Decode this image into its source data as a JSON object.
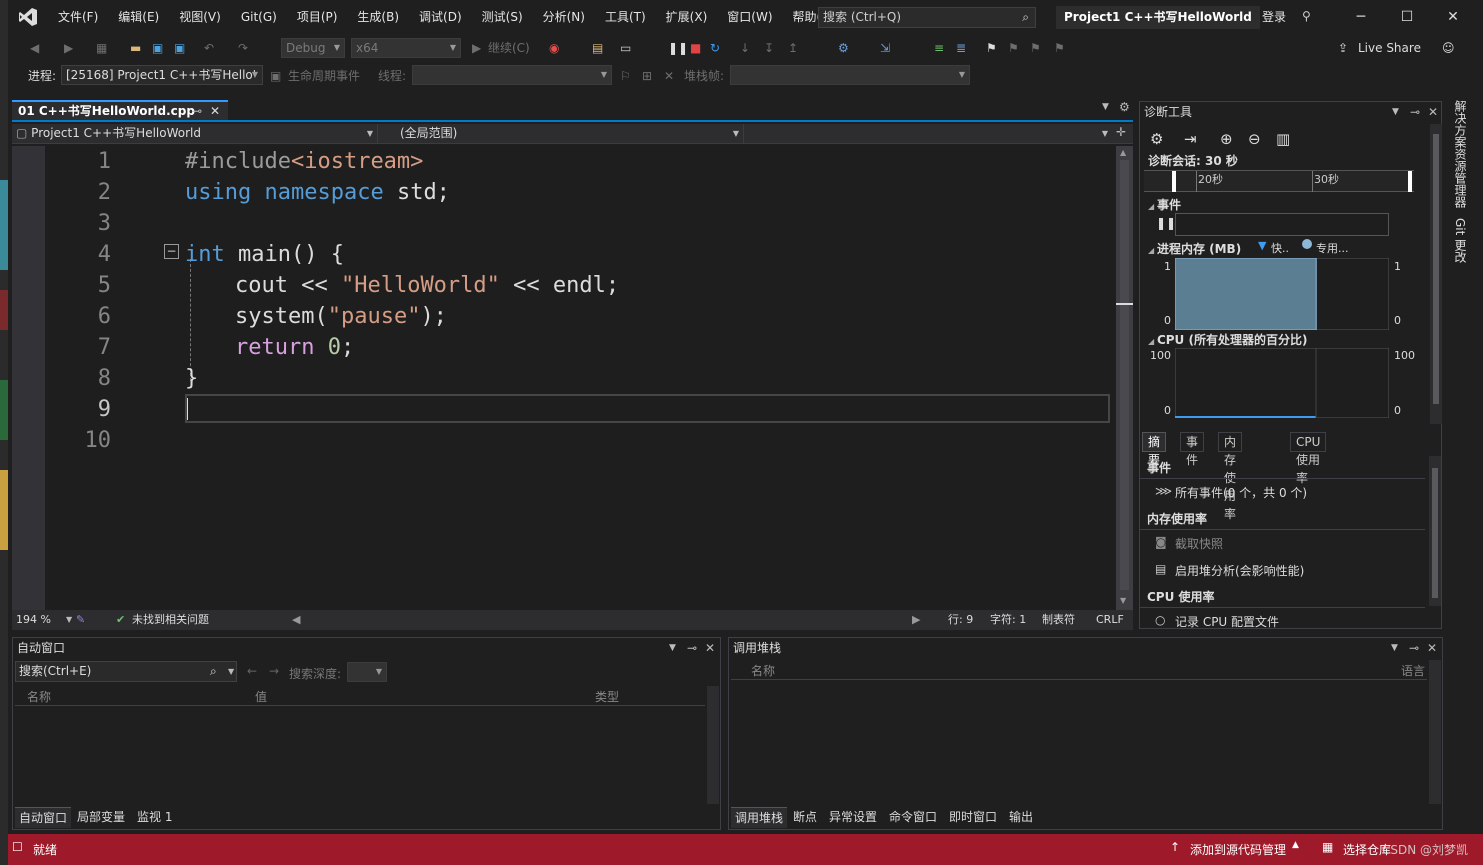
{
  "menu": [
    "文件(F)",
    "编辑(E)",
    "视图(V)",
    "Git(G)",
    "项目(P)",
    "生成(B)",
    "调试(D)",
    "测试(S)",
    "分析(N)",
    "工具(T)",
    "扩展(X)",
    "窗口(W)",
    "帮助(H)"
  ],
  "search": {
    "placeholder": "搜索 (Ctrl+Q)"
  },
  "window_title": "Project1 C++书写HelloWorld",
  "login": "登录",
  "toolbar": {
    "config": "Debug",
    "platform": "x64",
    "continue": "继续(C)",
    "live_share": "Live Share"
  },
  "debugbar": {
    "process_label": "进程:",
    "process": "[25168] Project1 C++书写Hello'",
    "lifecycle": "生命周期事件",
    "thread_label": "线程:",
    "stack_label": "堆栈帧:"
  },
  "editor": {
    "tab": "01 C++书写HelloWorld.cpp",
    "nav_project": "Project1 C++书写HelloWorld",
    "nav_scope": "(全局范围)",
    "line_numbers": [
      "1",
      "2",
      "3",
      "4",
      "5",
      "6",
      "7",
      "8",
      "9",
      "10"
    ],
    "code": {
      "l1a": "#include",
      "l1b": "<iostream>",
      "l2a": "using",
      "l2b": "namespace",
      "l2c": " std;",
      "l4a": "int",
      "l4b": " main() {",
      "l5a": "cout << ",
      "l5b": "\"HelloWorld\"",
      "l5c": " << endl;",
      "l6a": "system(",
      "l6b": "\"pause\"",
      "l6c": ");",
      "l7a": "return",
      "l7b": "0",
      "l7c": ";",
      "l8": "}"
    },
    "zoom": "194 %",
    "issues": "未找到相关问题",
    "line": "行: 9",
    "char": "字符: 1",
    "tabs": "制表符",
    "eol": "CRLF"
  },
  "diag": {
    "title": "诊断工具",
    "session": "诊断会话: 30 秒",
    "tick20": "20秒",
    "tick30": "30秒",
    "events": "事件",
    "memory": "进程内存 (MB)",
    "mem_leg1": "快..",
    "mem_leg2": "专用...",
    "mem_max": "1",
    "mem_min": "0",
    "cpu": "CPU (所有处理器的百分比)",
    "cpu_max": "100",
    "cpu_min": "0",
    "tabs": [
      "摘要",
      "事件",
      "内存使用率",
      "CPU 使用率"
    ],
    "sum_events": "事件",
    "all_events": "所有事件(0 个，共 0 个)",
    "mem_usage": "内存使用率",
    "snapshot": "截取快照",
    "heap": "启用堆分析(会影响性能)",
    "cpu_usage": "CPU 使用率",
    "cpu_profile": "记录 CPU 配置文件"
  },
  "chart_data": [
    {
      "type": "area",
      "title": "进程内存 (MB)",
      "series": [
        {
          "name": "快..",
          "values": [
            1,
            1,
            1,
            1,
            1,
            1,
            1,
            1,
            1,
            1,
            1
          ]
        },
        {
          "name": "专用...",
          "values": []
        }
      ],
      "ylim": [
        0,
        1
      ]
    },
    {
      "type": "line",
      "title": "CPU (所有处理器的百分比)",
      "series": [
        {
          "values": [
            0,
            0,
            0,
            0,
            0,
            0,
            0,
            0,
            0,
            0,
            0
          ]
        }
      ],
      "ylim": [
        0,
        100
      ]
    }
  ],
  "autos": {
    "title": "自动窗口",
    "search": "搜索(Ctrl+E)",
    "depth": "搜索深度:",
    "col_name": "名称",
    "col_value": "值",
    "col_type": "类型",
    "tabs": [
      "自动窗口",
      "局部变量",
      "监视 1"
    ]
  },
  "callstack": {
    "title": "调用堆栈",
    "col_name": "名称",
    "col_lang": "语言",
    "tabs": [
      "调用堆栈",
      "断点",
      "异常设置",
      "命令窗口",
      "即时窗口",
      "输出"
    ]
  },
  "side": {
    "solution": "解决方案资源管理器",
    "git": "Git 更改"
  },
  "status": {
    "ready": "就绪",
    "add_source": "添加到源代码管理",
    "select_repo": "选择仓库",
    "watermark": "CSDN @刘梦凯"
  },
  "colors": {
    "accent": "#007acc",
    "statusbar": "#9e1a2a",
    "keyword": "#569cd6",
    "string": "#d69d85"
  }
}
